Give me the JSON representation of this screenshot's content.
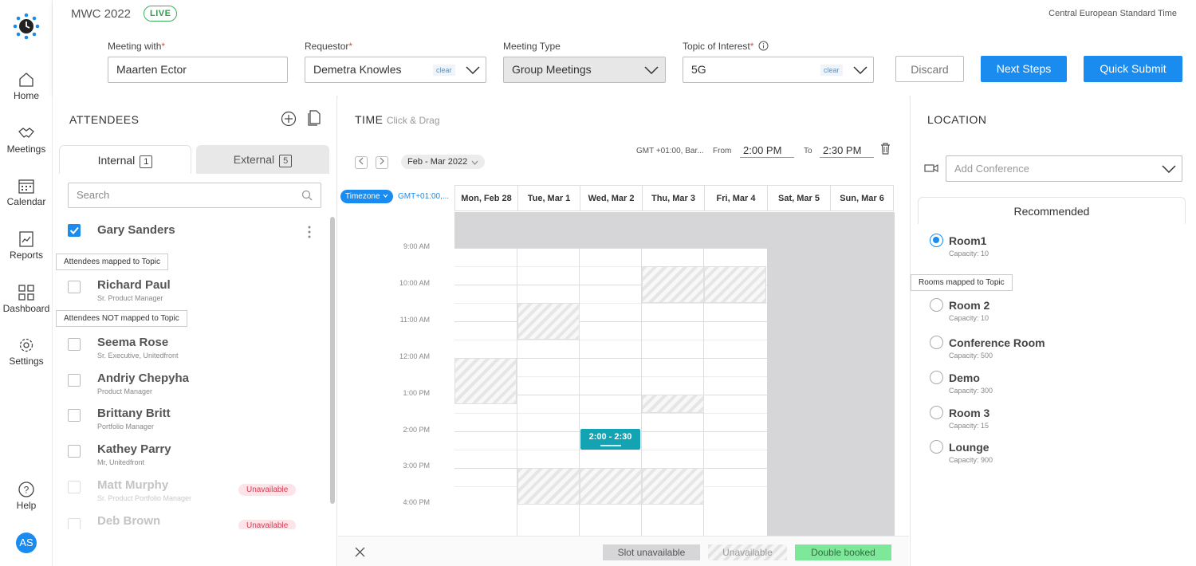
{
  "app": {
    "title": "MWC 2022",
    "status": "LIVE",
    "timezone": "Central European Standard Time"
  },
  "nav": {
    "items": [
      {
        "label": "Home",
        "icon": "home-icon"
      },
      {
        "label": "Meetings",
        "icon": "handshake-icon"
      },
      {
        "label": "Calendar",
        "icon": "calendar-icon"
      },
      {
        "label": "Reports",
        "icon": "reports-icon"
      },
      {
        "label": "Dashboard",
        "icon": "dashboard-icon"
      },
      {
        "label": "Settings",
        "icon": "gear-icon"
      }
    ],
    "help": "Help",
    "avatar": "AS"
  },
  "form": {
    "meeting_with": {
      "label": "Meeting with",
      "required": "*",
      "value": "Maarten Ector"
    },
    "requestor": {
      "label": "Requestor",
      "required": "*",
      "value": "Demetra Knowles",
      "clear": "clear"
    },
    "meeting_type": {
      "label": "Meeting Type",
      "value": "Group Meetings"
    },
    "topic": {
      "label": "Topic of Interest",
      "required": "*",
      "value": "5G",
      "clear": "clear"
    },
    "discard": "Discard",
    "next_steps": "Next Steps",
    "quick_submit": "Quick Submit"
  },
  "attendees": {
    "title": "ATTENDEES",
    "tabs": [
      {
        "label": "Internal",
        "count": "1"
      },
      {
        "label": "External",
        "count": "5"
      }
    ],
    "search_placeholder": "Search",
    "mapped_label": "Attendees mapped to Topic",
    "not_mapped_label": "Attendees NOT mapped to Topic",
    "people": [
      {
        "name": "Gary Sanders",
        "role": "",
        "checked": true
      },
      {
        "name": "Richard Paul",
        "role": "Sr. Product Manager"
      },
      {
        "name": "Seema Rose",
        "role": "Sr. Executive, Unitedfront"
      },
      {
        "name": "Andriy Chepyha",
        "role": "Product Manager"
      },
      {
        "name": "Brittany Britt",
        "role": "Portfolio Manager"
      },
      {
        "name": "Kathey Parry",
        "role": "Mr, Unitedfront"
      },
      {
        "name": "Matt Murphy",
        "role": "Sr. Product Portfolio Manager",
        "badge": "Unavailable"
      },
      {
        "name": "Deb Brown",
        "role": "",
        "badge": "Unavailable"
      }
    ]
  },
  "time": {
    "title": "TIME",
    "subtitle": "Click & Drag",
    "range": "Feb - Mar 2022",
    "gmt": "GMT +01:00, Bar...",
    "from_label": "From",
    "from_value": "2:00 PM",
    "to_label": "To",
    "to_value": "2:30 PM",
    "timezone_btn": "Timezone",
    "timezone_value": "GMT+01:00,...",
    "days": [
      "Mon, Feb 28",
      "Tue, Mar 1",
      "Wed, Mar 2",
      "Thu, Mar 3",
      "Fri, Mar 4",
      "Sat, Mar 5",
      "Sun, Mar 6"
    ],
    "hours": [
      "9:00 AM",
      "10:00 AM",
      "11:00 AM",
      "12:00 AM",
      "1:00 PM",
      "2:00 PM",
      "3:00 PM",
      "4:00 PM"
    ],
    "selected_slot": "2:00 - 2:30",
    "legend": {
      "slot_unavailable": "Slot unavailable",
      "unavailable": "Unavailable",
      "double_booked": "Double booked"
    }
  },
  "location": {
    "title": "LOCATION",
    "conference_placeholder": "Add Conference",
    "recommended_tab": "Recommended",
    "mapped_label": "Rooms mapped to Topic",
    "capacity_label": "Capacity:",
    "rooms": [
      {
        "name": "Room1",
        "capacity": "10",
        "selected": true
      },
      {
        "name": "Room 2",
        "capacity": "10"
      },
      {
        "name": "Conference Room",
        "capacity": "500"
      },
      {
        "name": "Demo",
        "capacity": "300"
      },
      {
        "name": "Room 3",
        "capacity": "15"
      },
      {
        "name": "Lounge",
        "capacity": "900"
      }
    ]
  },
  "colors": {
    "accent": "#1a8cf0",
    "live": "#35b35a",
    "slot": "#13a3b3",
    "unavailable_badge": "#d9394e",
    "double_booked": "#7ee89a"
  }
}
